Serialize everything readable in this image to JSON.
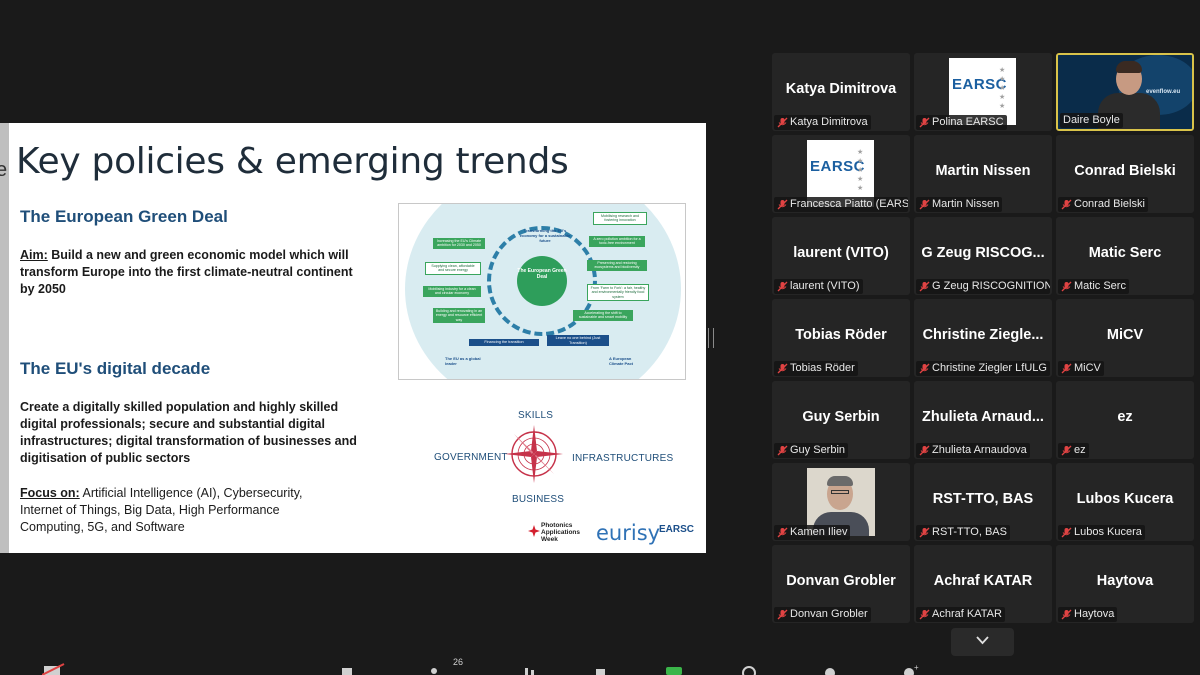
{
  "slide": {
    "edge_letter": "e",
    "title": "Key policies & emerging trends",
    "green_deal": {
      "heading": "The European Green Deal",
      "aim_label": "Aim:",
      "aim_text": "Build a new and green economic model which will transform Europe into the first climate-neutral continent by 2050"
    },
    "digital": {
      "heading": "The EU's digital decade",
      "text": "Create a digitally skilled population and highly skilled digital professionals; secure and substantial digital infrastructures; digital transformation of businesses and digitisation of public sectors",
      "focus_label": "Focus on:",
      "focus_text": "Artificial Intelligence (AI), Cybersecurity, Internet of Things, Big Data, High Performance Computing, 5G, and Software"
    },
    "diagram": {
      "center": "The European Green Deal",
      "top": "Transforming the EU's economy for a sustainable future",
      "left_boxes": [
        "Increasing the EU's Climate ambition for 2030 and 2050",
        "Supplying clean, affordable and secure energy",
        "Mobilising industry for a clean and circular economy",
        "Building and renovating in an energy and resource efficient way"
      ],
      "right_boxes": [
        "Mobilising research and fostering innovation",
        "A zero pollution ambition for a toxic-free environment",
        "Preserving and restoring ecosystems and biodiversity",
        "From 'Farm to Fork': a fair, healthy and environmentally friendly food system",
        "Accelerating the shift to sustainable and smart mobility"
      ],
      "bottom_left": "Financing the transition",
      "bottom_right": "Leave no one behind (Just Transition)",
      "corner_left": "The EU as a global leader",
      "corner_right": "A European Climate Pact"
    },
    "compass": {
      "top": "SKILLS",
      "left": "GOVERNMENT",
      "right": "INFRASTRUCTURES",
      "bottom": "BUSINESS"
    },
    "logos": {
      "photonics": "Photonics Applications Week",
      "eurisy": "eurisy",
      "earsc": "EARSC"
    }
  },
  "participants": [
    {
      "display": "Katya Dimitrova",
      "label": "Katya Dimitrova",
      "type": "name"
    },
    {
      "display": "",
      "label": "Polina EARSC",
      "type": "logo",
      "logo_text": "EARSC"
    },
    {
      "display": "",
      "label": "Daire Boyle",
      "type": "video",
      "brand": "evenflow.eu"
    },
    {
      "display": "",
      "label": "Francesca Piatto (EARS...",
      "type": "logo",
      "logo_text": "EARSC"
    },
    {
      "display": "Martin Nissen",
      "label": "Martin Nissen",
      "type": "name"
    },
    {
      "display": "Conrad Bielski",
      "label": "Conrad Bielski",
      "type": "name"
    },
    {
      "display": "laurent (VITO)",
      "label": "laurent (VITO)",
      "type": "name"
    },
    {
      "display": "G Zeug RISCOG...",
      "label": "G Zeug RISCOGNITION",
      "type": "name"
    },
    {
      "display": "Matic Serc",
      "label": "Matic Serc",
      "type": "name"
    },
    {
      "display": "Tobias Röder",
      "label": "Tobias Röder",
      "type": "name"
    },
    {
      "display": "Christine Ziegle...",
      "label": "Christine Ziegler LfULG",
      "type": "name"
    },
    {
      "display": "MiCV",
      "label": "MiCV",
      "type": "name"
    },
    {
      "display": "Guy Serbin",
      "label": "Guy Serbin",
      "type": "name"
    },
    {
      "display": "Zhulieta Arnaud...",
      "label": "Zhulieta Arnaudova",
      "type": "name"
    },
    {
      "display": "ez",
      "label": "ez",
      "type": "name"
    },
    {
      "display": "",
      "label": "Kamen Iliev",
      "type": "photo"
    },
    {
      "display": "RST-TTO, BAS",
      "label": "RST-TTO, BAS",
      "type": "name"
    },
    {
      "display": "Lubos Kucera",
      "label": "Lubos Kucera",
      "type": "name"
    },
    {
      "display": "Donvan Grobler",
      "label": "Donvan Grobler",
      "type": "name"
    },
    {
      "display": "Achraf KATAR",
      "label": "Achraf KATAR",
      "type": "name"
    },
    {
      "display": "Haytova",
      "label": "Haytova",
      "type": "name"
    }
  ],
  "toolbar": {
    "participants_count": "26"
  },
  "colors": {
    "background": "#1a1a1a",
    "tile": "#252525",
    "active_speaker_border": "#d9c34a",
    "muted_icon": "#e04343",
    "title_blue": "#1f4e79",
    "green": "#3aa55d"
  }
}
